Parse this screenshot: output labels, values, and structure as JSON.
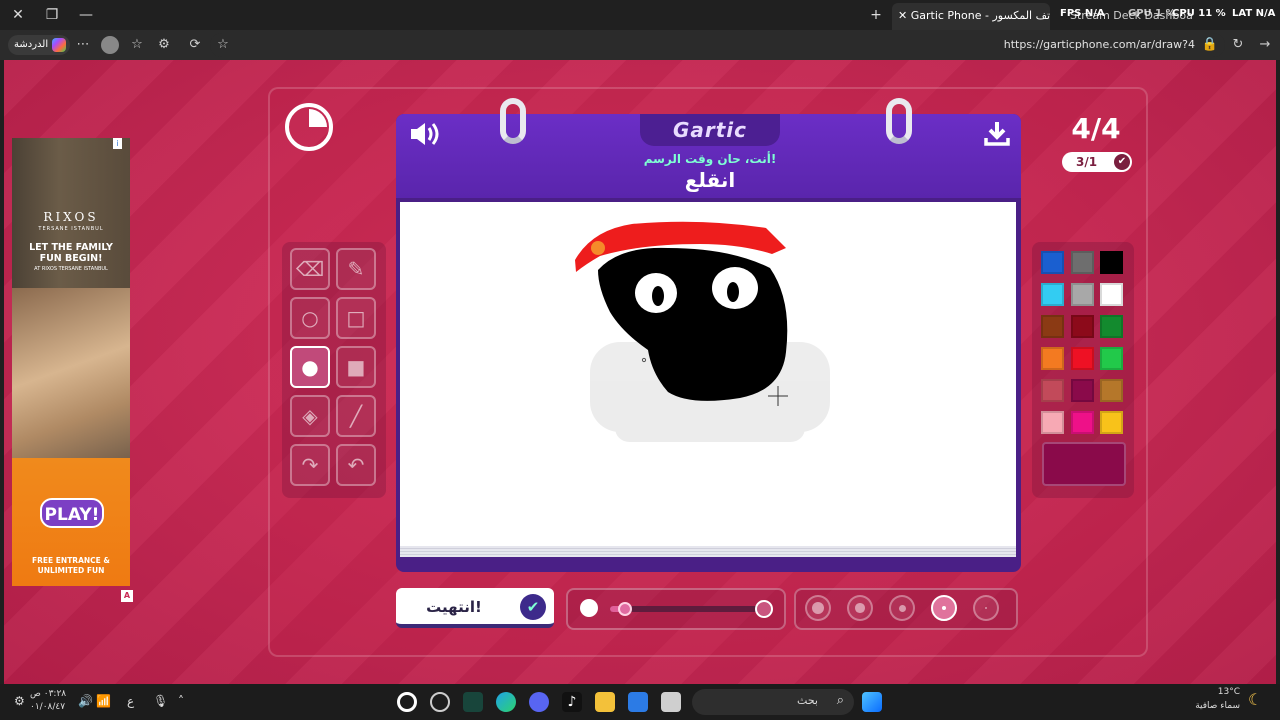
{
  "browser": {
    "tabs": [
      {
        "label": "Gartic Phone - لعبة الهاتف المكسور",
        "active": true
      },
      {
        "label": "Stream Deck Dashboard",
        "active": false
      }
    ],
    "performance": {
      "fps_label": "FPS",
      "fps_value": "N/A",
      "gpu_label": "GPU",
      "gpu_value": "1 %",
      "cpu_label": "CPU",
      "cpu_value": "11 %",
      "lat_label": "LAT",
      "lat_value": "N/A"
    },
    "url": "https://garticphone.com/ar/draw?4",
    "chat_label": "الدردشة"
  },
  "ad": {
    "brand": "RIXOS",
    "brand_sub": "TERSANE ISTANBUL",
    "headline": "LET THE FAMILY FUN BEGIN!",
    "sub": "AT RIXOS TERSANE ISTANBUL",
    "play": "PLAY!",
    "cta": "FREE ENTRANCE & UNLIMITED FUN",
    "corner_info": "i",
    "corner_badge": "A"
  },
  "game": {
    "logo": "Gartic",
    "round": "4/4",
    "players_done": "3/1",
    "hint": "أنت، حان وقت الرسم!",
    "word": "انقلع",
    "done_label": "انتهيت!",
    "tools": [
      {
        "name": "eraser",
        "icon": "⌫",
        "selected": false
      },
      {
        "name": "pencil",
        "icon": "✎",
        "selected": false
      },
      {
        "name": "ellipse-outline",
        "icon": "○",
        "selected": false
      },
      {
        "name": "rectangle-outline",
        "icon": "□",
        "selected": false
      },
      {
        "name": "ellipse-filled",
        "icon": "●",
        "selected": true
      },
      {
        "name": "rectangle-filled",
        "icon": "■",
        "selected": false
      },
      {
        "name": "bucket",
        "icon": "◈",
        "selected": false
      },
      {
        "name": "line",
        "icon": "╱",
        "selected": false
      },
      {
        "name": "redo",
        "icon": "↷",
        "selected": false
      },
      {
        "name": "undo",
        "icon": "↶",
        "selected": false
      }
    ],
    "palette": [
      "#1a5fd0",
      "#6e6e6e",
      "#000000",
      "#33ccf2",
      "#a8a8a8",
      "#ffffff",
      "#8b3a14",
      "#8c0a1a",
      "#138a2e",
      "#f37a21",
      "#ee1124",
      "#22c94a",
      "#c24a5a",
      "#8a0a4a",
      "#b5772a",
      "#f7a9b4",
      "#ee1188",
      "#f8c21a"
    ],
    "current_color": "#8a0a4a",
    "opacity": 0.1,
    "brush_sizes": [
      4,
      3,
      2,
      1,
      0
    ],
    "selected_size_index": 3
  },
  "taskbar": {
    "time": "٠٣:٢٨ ص",
    "date": "٠١/٠٨/٤٧",
    "lang": "ع",
    "search_label": "بحث",
    "weather_temp": "13°C",
    "weather_desc": "سماء صافية"
  }
}
